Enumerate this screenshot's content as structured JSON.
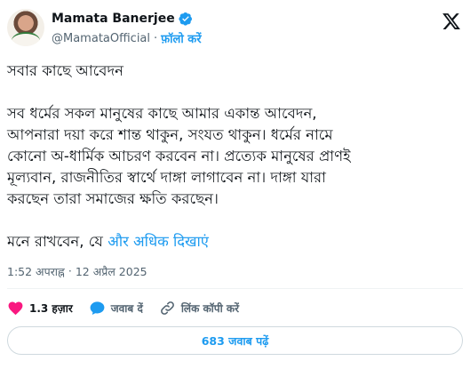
{
  "author": {
    "name": "Mamata Banerjee",
    "handle": "@MamataOfficial",
    "separator": "·",
    "follow_label": "फ़ॉलो करें"
  },
  "tweet": {
    "lines_p1": [
      "সবার কাছে আবেদন"
    ],
    "lines_p2": [
      "সব ধর্মের সকল মানুষের কাছে আমার একান্ত আবেদন,",
      "আপনারা দয়া করে শান্ত থাকুন, সংযত থাকুন। ধর্মের নামে",
      "কোনো অ-ধার্মিক আচরণ করবেন না। প্রত্যেক মানুষের প্রাণই",
      "মূল্যবান,  রাজনীতির স্বার্থে দাঙ্গা লাগাবেন না। দাঙ্গা যারা",
      "করছেন তারা সমাজের ক্ষতি করছেন।"
    ],
    "last_line": "মনে রাখবেন, যে",
    "show_more": "और अधिक दिखाएं"
  },
  "meta": {
    "time": "1:52 अपराह्न",
    "separator": "·",
    "date": "12 अप्रैल 2025"
  },
  "actions": {
    "like_count": "1.3 हज़ार",
    "reply_label": "जवाब दें",
    "copy_link_label": "लिंक कॉपी करें"
  },
  "replies_button": "683 जवाब पढ़ें",
  "colors": {
    "accent": "#1d9bf0",
    "like": "#f91880",
    "text": "#0f1419",
    "muted": "#536471"
  },
  "icons": {
    "verified": "verified-badge-icon",
    "logo": "x-logo-icon",
    "like": "heart-icon",
    "reply": "reply-bubble-icon",
    "link": "link-icon"
  }
}
